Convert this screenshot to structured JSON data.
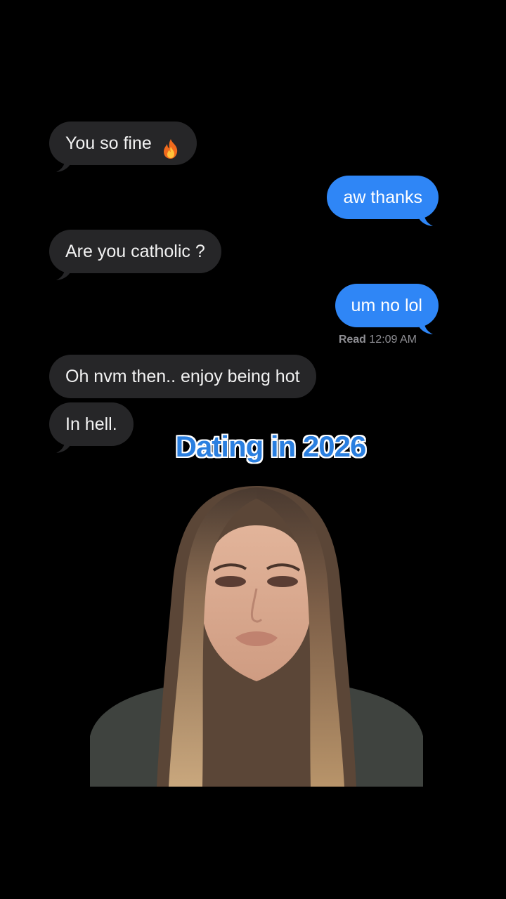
{
  "conversation": {
    "messages": [
      {
        "sender": "them",
        "text": "You so fine",
        "emoji": "fire-emoji"
      },
      {
        "sender": "me",
        "text": "aw thanks"
      },
      {
        "sender": "them",
        "text": "Are you catholic ?"
      },
      {
        "sender": "me",
        "text": "um no lol"
      },
      {
        "sender": "them",
        "text": "Oh nvm then.. enjoy being hot"
      },
      {
        "sender": "them",
        "text": "In hell."
      }
    ],
    "read_receipt": {
      "label": "Read",
      "time": "12:09 AM"
    }
  },
  "overlay": {
    "caption": "Dating in 2026"
  },
  "colors": {
    "background": "#000000",
    "incoming_bubble": "#262628",
    "outgoing_bubble": "#2f86f6",
    "caption": "#2a7fe0"
  }
}
